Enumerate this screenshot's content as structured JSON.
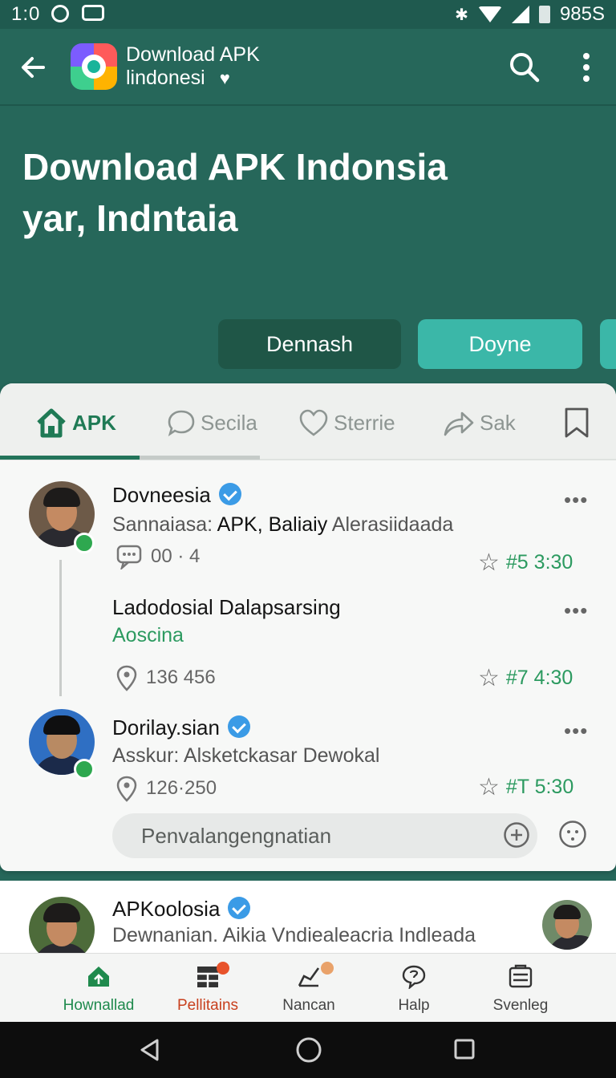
{
  "status_bar": {
    "time": "1:0",
    "right_text": "985S"
  },
  "app_bar": {
    "title_line1": "Download APK",
    "title_line2": "lindonesi",
    "icons": [
      "back-arrow-icon",
      "app-logo",
      "heart-icon",
      "search-icon",
      "more-vert-icon"
    ]
  },
  "hero": {
    "title_line1": "Download APK Indonsia",
    "title_line2": "yar, Indntaia",
    "buttons": [
      "Dennash",
      "Doyne"
    ]
  },
  "tabs": [
    {
      "label": "APK",
      "icon": "home-icon",
      "active": true
    },
    {
      "label": "Secila",
      "icon": "chat-bubble-icon",
      "active": false
    },
    {
      "label": "Sterrie",
      "icon": "heart-icon",
      "active": false
    },
    {
      "label": "Sak",
      "icon": "share-icon",
      "active": false
    },
    {
      "label": "",
      "icon": "bookmark-icon",
      "active": false
    }
  ],
  "posts": [
    {
      "name": "Dovneesia",
      "verified": true,
      "subtitle_prefix": "Sannaiasa: ",
      "subtitle_bold": "APK, Baliaiy",
      "subtitle_rest": " Alerasiidaada",
      "meta": "00 · 4",
      "rank": "#5 3:30",
      "more": "•••"
    },
    {
      "name": "Ladodosial Dalapsarsing",
      "link": "Aoscina",
      "meta": "136 456",
      "rank": "#7 4:30",
      "more": "•••"
    },
    {
      "name": "Dorilay.sian",
      "verified": true,
      "subtitle": "Asskur: Alsketckasar Dewokal",
      "meta": "126·250",
      "rank": "#T 5:30",
      "more": "•••"
    }
  ],
  "reply": {
    "placeholder": "Penvalangengnatian"
  },
  "next_post": {
    "name": "APKoolosia",
    "verified": true,
    "subtitle": "Dewnanian. Aikia Vndiealeacria Indleada"
  },
  "bottom_nav": [
    {
      "label": "Hownallad",
      "icon": "home-icon",
      "color": "#1f8a4d",
      "active": true
    },
    {
      "label": "Pellitains",
      "icon": "grid-icon",
      "color": "#c8401e",
      "badge": true
    },
    {
      "label": "Nancan",
      "icon": "chart-icon",
      "color": "#333333",
      "badge": true
    },
    {
      "label": "Halp",
      "icon": "help-bubble-icon",
      "color": "#333333"
    },
    {
      "label": "Svenleg",
      "icon": "settings-list-icon",
      "color": "#333333"
    }
  ],
  "colors": {
    "primary": "#26675a",
    "accent": "#3bb7a8",
    "active_green": "#1f7a55",
    "verified_blue": "#3b9be6"
  }
}
